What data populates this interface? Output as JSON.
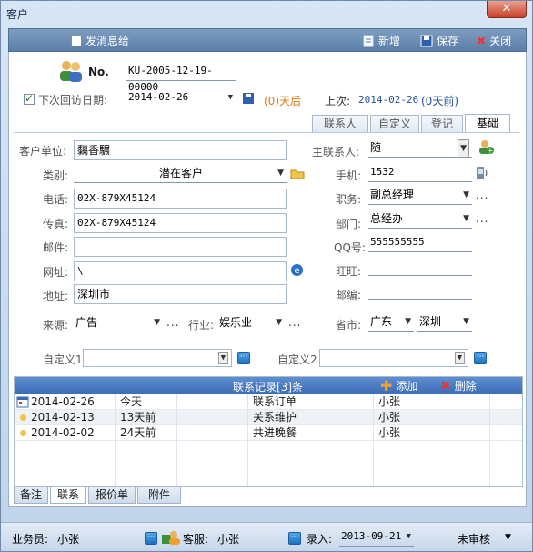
{
  "window": {
    "title": "客户"
  },
  "toolbar": {
    "send_message": "发消息给",
    "add_label": "新增",
    "save_label": "保存",
    "close_label": "关闭"
  },
  "header": {
    "no_label": "No.",
    "no_value": "KU-2005-12-19-00000",
    "next_visit_label": "下次回访日期:",
    "next_visit_date": "2014-02-26",
    "next_visit_status": "(0)天后",
    "last_visit_label": "上次:",
    "last_visit_date": "2014-02-26",
    "last_visit_status": "(0天前)"
  },
  "tabs_top": [
    "联系人",
    "自定义",
    "登记",
    "基础"
  ],
  "form": {
    "company_label": "客户单位:",
    "company_value": "黐香𩥇",
    "category_label": "类别:",
    "category_value": "潜在客户",
    "phone_label": "电话:",
    "phone_value": "02X-879X45124",
    "fax_label": "传真:",
    "fax_value": "02X-879X45124",
    "email_label": "邮件:",
    "email_value": "",
    "website_label": "网址:",
    "website_value": "\\",
    "address_label": "地址:",
    "address_value": "深圳市",
    "source_label": "来源:",
    "source_value": "广告",
    "industry_label": "行业:",
    "industry_value": "娱乐业",
    "main_contact_label": "主联系人:",
    "main_contact_value": "随",
    "mobile_label": "手机:",
    "mobile_value": "1532",
    "position_label": "职务:",
    "position_value": "副总经理",
    "department_label": "部门:",
    "department_value": "总经办",
    "qq_label": "QQ号:",
    "qq_value": "555555555",
    "wangwang_label": "旺旺:",
    "wangwang_value": "",
    "postcode_label": "邮编:",
    "postcode_value": "",
    "province_label": "省市:",
    "province_value": "广东",
    "city_value": "深圳",
    "custom1_label": "自定义1",
    "custom2_label": "自定义2"
  },
  "contact_grid": {
    "title": "联系记录[3]条",
    "add_label": "添加",
    "delete_label": "删除",
    "rows": [
      {
        "date": "2014-02-26",
        "ago": "今天",
        "subject": "联系订单",
        "person": "小张"
      },
      {
        "date": "2014-02-13",
        "ago": "13天前",
        "subject": "关系维护",
        "person": "小张"
      },
      {
        "date": "2014-02-02",
        "ago": "24天前",
        "subject": "共进晚餐",
        "person": "小张"
      }
    ]
  },
  "bottom_tabs": [
    "备注",
    "联系",
    "报价单",
    "附件"
  ],
  "status": {
    "salesman_label": "业务员:",
    "salesman_value": "小张",
    "service_label": "客服:",
    "service_value": "小张",
    "entry_label": "录入:",
    "entry_date": "2013-09-21",
    "audit_label": "未审核"
  },
  "colors": {
    "accent": "#3a6bb5",
    "toolbar": "#5c7fa8",
    "warning": "#e07a10",
    "link": "#1f4f9a"
  }
}
